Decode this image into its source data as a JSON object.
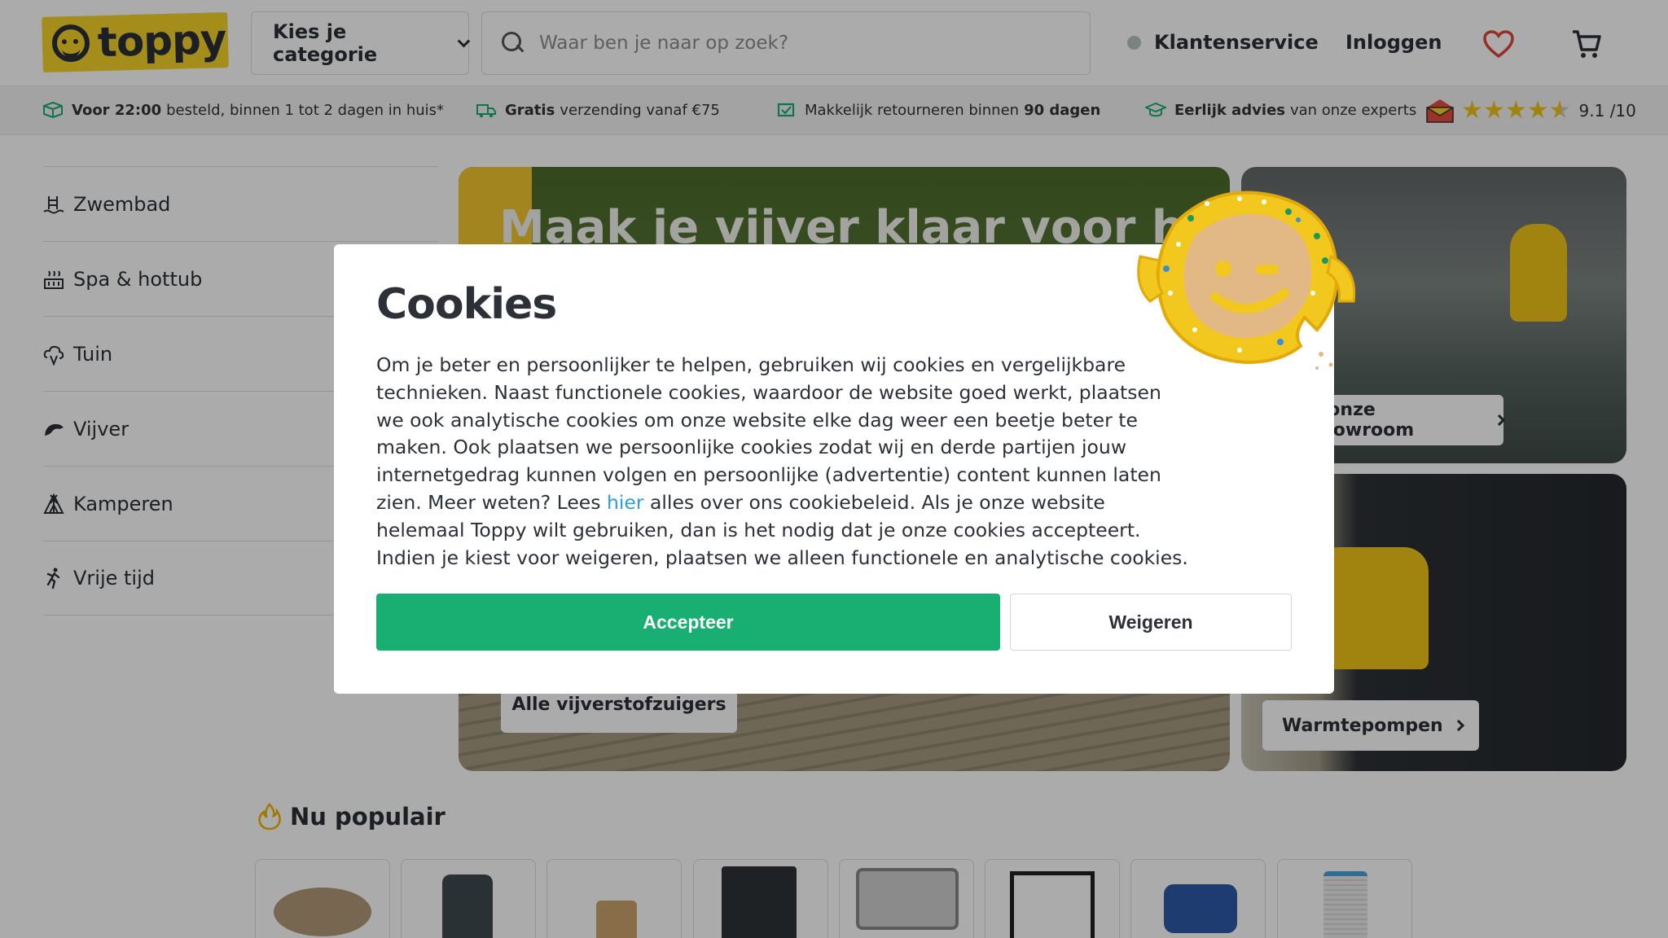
{
  "header": {
    "logo_text": "toppy",
    "category_label": "Kies je categorie",
    "search_placeholder": "Waar ben je naar op zoek?",
    "customer_service": "Klantenservice",
    "login": "Inloggen"
  },
  "usp": [
    {
      "bold": "Voor 22:00",
      "text": "besteld, binnen 1 tot 2 dagen in huis*",
      "icon": "package-icon"
    },
    {
      "bold": "Gratis",
      "text": "verzending vanaf €75",
      "icon": "truck-icon"
    },
    {
      "pre": "Makkelijk retourneren binnen",
      "bold": "90 dagen",
      "icon": "return-icon"
    },
    {
      "bold": "Eerlijk advies",
      "text": "van onze experts",
      "icon": "graduation-icon"
    }
  ],
  "rating": {
    "value": "9.1 /10",
    "stars": 4.5
  },
  "sidebar": [
    {
      "label": "Zwembad",
      "icon": "pool-icon"
    },
    {
      "label": "Spa & hottub",
      "icon": "spa-icon"
    },
    {
      "label": "Tuin",
      "icon": "garden-icon"
    },
    {
      "label": "Vijver",
      "icon": "pond-icon"
    },
    {
      "label": "Kamperen",
      "icon": "tent-icon"
    },
    {
      "label": "Vrije tijd",
      "icon": "leisure-icon"
    }
  ],
  "banners": {
    "main_title": "Maak je vijver klaar voor het",
    "main_button": "Alle vijverstofzuigers",
    "side1_button": "k onze showroom",
    "side2_button": "Warmtepompen"
  },
  "popular": {
    "title": "Nu populair",
    "products": [
      "inflatable-spa",
      "pond-vacuum",
      "wood-hot-tub",
      "heat-pump",
      "hottub",
      "football-goal",
      "pond-pump",
      "spa-filter"
    ]
  },
  "cookies": {
    "title": "Cookies",
    "text_before_link": "Om je beter en persoonlijker te helpen, gebruiken wij cookies en vergelijkbare technieken. Naast functionele cookies, waardoor de website goed werkt, plaatsen we ook analytische cookies om onze website elke dag weer een beetje beter te maken. Ook plaatsen we persoonlijke cookies zodat wij en derde partijen jouw internetgedrag kunnen volgen en persoonlijke (advertentie) content kunnen laten zien. Meer weten? Lees ",
    "link_text": "hier",
    "text_after_link": " alles over ons cookiebeleid. Als je onze website helemaal Toppy wilt gebruiken, dan is het nodig dat je onze cookies accepteert. Indien je kiest voor weigeren, plaatsen we alleen functionele en analytische cookies.",
    "accept": "Accepteer",
    "refuse": "Weigeren"
  },
  "colors": {
    "brand_yellow": "#f6d22a",
    "accept_green": "#19ae72",
    "link_blue": "#2a9fd8",
    "star": "#f0c419"
  }
}
